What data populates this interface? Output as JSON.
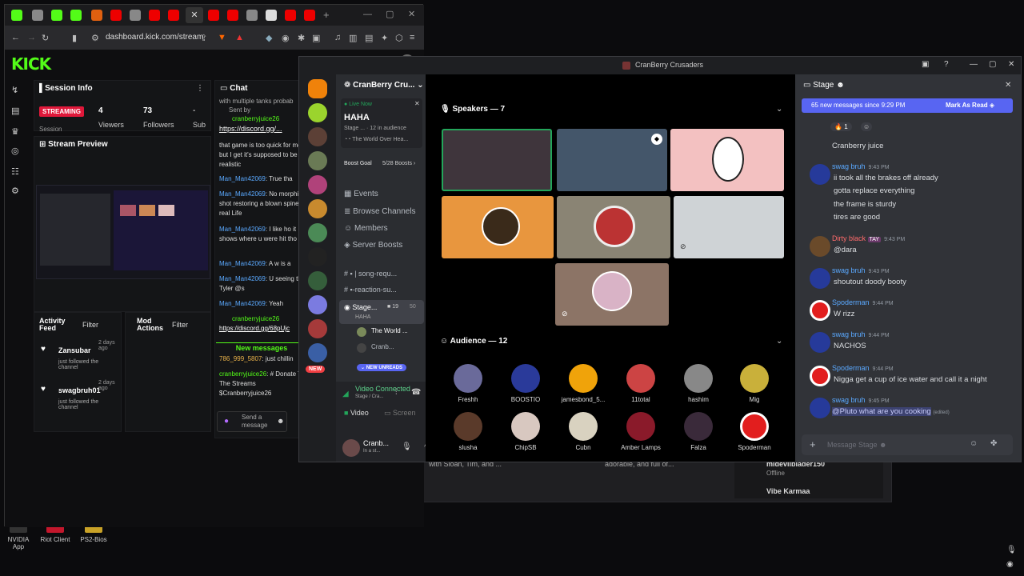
{
  "desktop": {
    "icons": [
      "NVIDIA App",
      "Riot Client",
      "PS2-Bios"
    ]
  },
  "browser": {
    "url": "dashboard.kick.com/stream"
  },
  "kick": {
    "logo": "KICK",
    "session_info": {
      "title": "Session Info",
      "status": "STREAMING",
      "viewers_value": "4",
      "viewers_label": "Viewers",
      "followers_value": "73",
      "followers_label": "Followers",
      "subs_value": "-",
      "subs_label": "Sub",
      "session_label": "Session"
    },
    "stream_preview": "Stream Preview",
    "activity_feed": {
      "title": "Activity Feed",
      "filter": "Filter",
      "items": [
        {
          "user": "Zansubar",
          "time": "2 days ago",
          "text": "just followed the channel"
        },
        {
          "user": "swagbruh01",
          "time": "2 days ago",
          "text": "just followed the channel"
        }
      ]
    },
    "mod_actions": {
      "title": "Mod Actions",
      "filter": "Filter"
    },
    "chat": {
      "title": "Chat",
      "lines": [
        {
          "user": "",
          "text": "with multiple tanks probab"
        },
        {
          "user": "Sent by",
          "text": ""
        },
        {
          "user": "cranberryjuice26",
          "text": "https://discord.gg/..."
        },
        {
          "user": "",
          "text": "that game is too quick for me but I get it's supposed to be realistic"
        },
        {
          "user": "Man_Man42069",
          "text": ": True tha"
        },
        {
          "user": "Man_Man42069",
          "text": ": No morphine shot restoring a blown spine in real Life"
        },
        {
          "user": "Man_Man42069",
          "text": ": I like ho it shows where u were hit tho"
        },
        {
          "user": "Man_Man42069",
          "text": ": A w is a"
        },
        {
          "user": "Man_Man42069",
          "text": ": U seeing the Tyler @s"
        },
        {
          "user": "Man_Man42069",
          "text": ": Yeah"
        },
        {
          "user": "cranberryjuice26",
          "text": "https://discord.gg/68pUjc"
        },
        {
          "user": "786_999_5807",
          "text": ": just chillin"
        },
        {
          "user": "cranberryjuice26",
          "text": ": # Donate To The Streams $Cranberryjuice26"
        }
      ],
      "new_messages": "New messages",
      "send_placeholder": "Send a message"
    }
  },
  "discord": {
    "window_title": "CranBerry Crusaders",
    "server_name": "CranBerry Cru...",
    "live_now": "Live Now",
    "live_title": "HAHA",
    "live_sub": "Stage ... · 12 in audience",
    "live_activity": "The World Over Hea...",
    "boost_goal": "Boost Goal",
    "boost_count": "5/28 Boosts",
    "menu": [
      "Events",
      "Browse Channels",
      "Members",
      "Server Boosts"
    ],
    "channels": [
      "| song-requ...",
      "-reaction-su...",
      "Stage...",
      "HAHA",
      "The World ...",
      "Cranb..."
    ],
    "stage_count": "19",
    "stage_cap": "50",
    "new_unreads": "NEW UNREADS",
    "new_badge": "NEW",
    "voice_connected": "Video Connected",
    "voice_sub": "Stage / Cra...",
    "video_btn": "Video",
    "screen_btn": "Screen",
    "user_name": "Cranb...",
    "user_status": "In a st...",
    "speakers_label": "Speakers — 7",
    "audience_label": "Audience — 12",
    "audience": [
      "Freshh",
      "BOOSTIO",
      "jamesbond_5...",
      "11total",
      "hashim",
      "Mig",
      "slusha",
      "ChipSB",
      "Cubn",
      "Amber Lamps",
      "Falza",
      "Spoderman"
    ],
    "chat_header": "Stage",
    "new_messages_bar": "65 new messages since 9:29 PM",
    "mark_read": "Mark As Read",
    "reaction_count": "1",
    "messages": [
      {
        "user": "",
        "time": "",
        "lines": [
          "Cranberry juice"
        ]
      },
      {
        "user": "swag bruh",
        "time": "9:43 PM",
        "lines": [
          "ii took all the brakes off already",
          "gotta replace everything",
          "the frame is sturdy",
          "tires are good"
        ]
      },
      {
        "user": "Dirty black",
        "time": "9:43 PM",
        "tag": "TAY",
        "lines": [
          "@dara"
        ]
      },
      {
        "user": "swag bruh",
        "time": "9:43 PM",
        "lines": [
          "shoutout doody booty"
        ]
      },
      {
        "user": "Spoderman",
        "time": "9:44 PM",
        "lines": [
          "W rizz"
        ]
      },
      {
        "user": "swag bruh",
        "time": "9:44 PM",
        "lines": [
          "NACHOS"
        ]
      },
      {
        "user": "Spoderman",
        "time": "9:44 PM",
        "lines": [
          "Nigga get a cup of ice water and call it a night"
        ]
      },
      {
        "user": "swag bruh",
        "time": "9:45 PM",
        "lines": [
          "@Pluto what are you cooking"
        ],
        "edited": "(edited)"
      }
    ],
    "input_placeholder": "Message Stage"
  },
  "background_window": {
    "text1": "with Sloan, Tim, and ...",
    "text2": "adorable, and full of...",
    "user1": "mideviiblader150",
    "user1_status": "Offline",
    "user2": "Vibe Karmaa"
  },
  "colors": {
    "kick_green": "#53fc18",
    "discord_blurple": "#5865f2",
    "streaming_red": "#e0183a"
  }
}
